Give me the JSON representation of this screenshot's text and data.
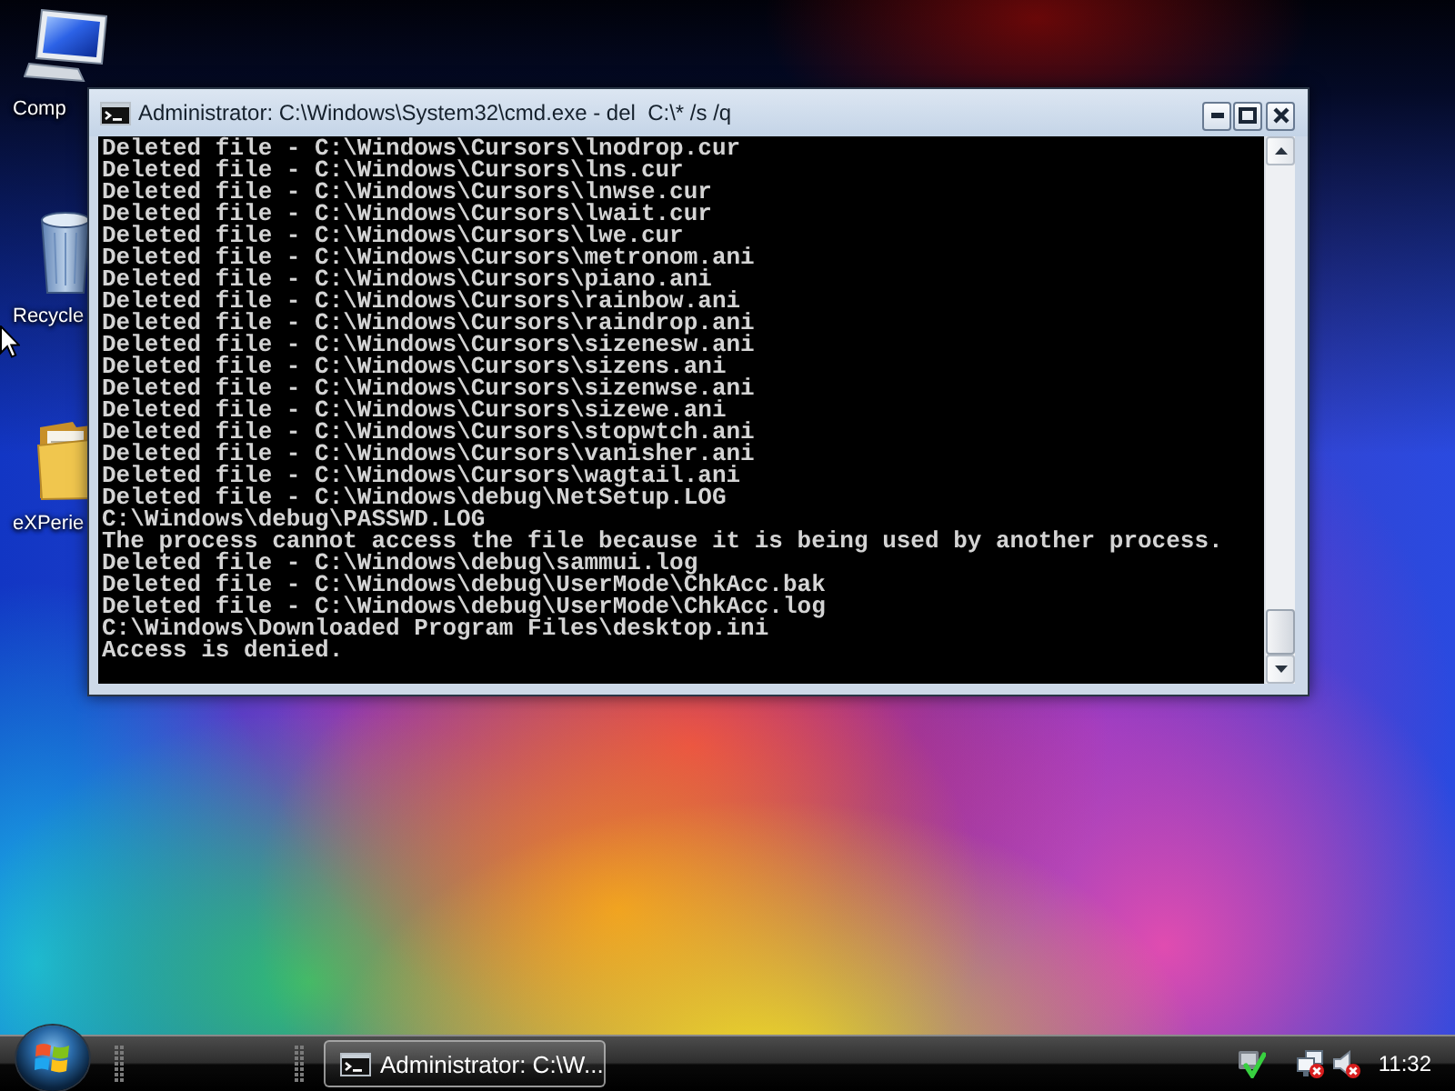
{
  "desktop": {
    "icons": [
      {
        "kind": "computer",
        "label": "Comp"
      },
      {
        "kind": "recycle_bin",
        "label": "Recycle"
      },
      {
        "kind": "folder",
        "label": "eXPerie"
      }
    ]
  },
  "window": {
    "title": "Administrator: C:\\Windows\\System32\\cmd.exe - del  C:\\* /s /q",
    "console_lines": [
      "Deleted file - C:\\Windows\\Cursors\\lnodrop.cur",
      "Deleted file - C:\\Windows\\Cursors\\lns.cur",
      "Deleted file - C:\\Windows\\Cursors\\lnwse.cur",
      "Deleted file - C:\\Windows\\Cursors\\lwait.cur",
      "Deleted file - C:\\Windows\\Cursors\\lwe.cur",
      "Deleted file - C:\\Windows\\Cursors\\metronom.ani",
      "Deleted file - C:\\Windows\\Cursors\\piano.ani",
      "Deleted file - C:\\Windows\\Cursors\\rainbow.ani",
      "Deleted file - C:\\Windows\\Cursors\\raindrop.ani",
      "Deleted file - C:\\Windows\\Cursors\\sizenesw.ani",
      "Deleted file - C:\\Windows\\Cursors\\sizens.ani",
      "Deleted file - C:\\Windows\\Cursors\\sizenwse.ani",
      "Deleted file - C:\\Windows\\Cursors\\sizewe.ani",
      "Deleted file - C:\\Windows\\Cursors\\stopwtch.ani",
      "Deleted file - C:\\Windows\\Cursors\\vanisher.ani",
      "Deleted file - C:\\Windows\\Cursors\\wagtail.ani",
      "Deleted file - C:\\Windows\\debug\\NetSetup.LOG",
      "C:\\Windows\\debug\\PASSWD.LOG",
      "The process cannot access the file because it is being used by another process.",
      "Deleted file - C:\\Windows\\debug\\sammui.log",
      "Deleted file - C:\\Windows\\debug\\UserMode\\ChkAcc.bak",
      "Deleted file - C:\\Windows\\debug\\UserMode\\ChkAcc.log",
      "C:\\Windows\\Downloaded Program Files\\desktop.ini",
      "Access is denied."
    ]
  },
  "taskbar": {
    "tasks": [
      {
        "label": "Administrator: C:\\W...",
        "selected": true
      }
    ],
    "tray_icons": [
      {
        "kind": "security",
        "alert": false
      },
      {
        "kind": "network",
        "alert": true
      },
      {
        "kind": "volume",
        "alert": true
      }
    ],
    "clock": "11:32"
  }
}
